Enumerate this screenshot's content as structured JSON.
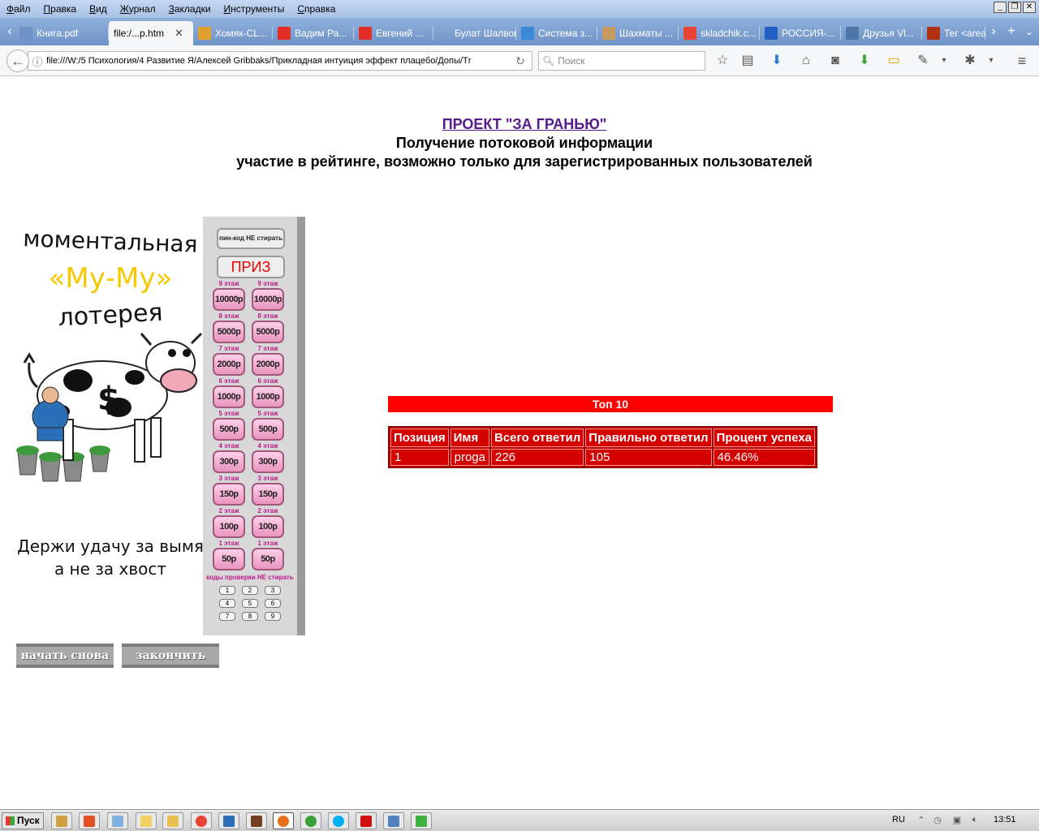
{
  "menu": [
    "Файл",
    "Правка",
    "Вид",
    "Журнал",
    "Закладки",
    "Инструменты",
    "Справка"
  ],
  "tabs": [
    {
      "label": "Книга.pdf",
      "icon": "pdf-icon",
      "color": "#6f93c6",
      "active": false
    },
    {
      "label": "file:/...p.htm",
      "icon": "none",
      "color": "#f5f6f7",
      "active": true
    },
    {
      "label": "Хомяк-CL...",
      "icon": "hamster-icon",
      "color": "#e0a030",
      "active": false
    },
    {
      "label": "Вадим Ра...",
      "icon": "youtube-icon",
      "color": "#e52d27",
      "active": false
    },
    {
      "label": "Евгений ...",
      "icon": "youtube-icon",
      "color": "#e52d27",
      "active": false
    },
    {
      "label": "Булат Шалвов...",
      "icon": "none",
      "color": "#6f93c6",
      "active": false
    },
    {
      "label": "Система з...",
      "icon": "system-icon",
      "color": "#3a88d8",
      "active": false
    },
    {
      "label": "Шахматы ...",
      "icon": "chess-icon",
      "color": "#c89a60",
      "active": false
    },
    {
      "label": "skladchik.c...",
      "icon": "chrome-icon",
      "color": "#ea4335",
      "active": false
    },
    {
      "label": "РОССИЯ-...",
      "icon": "russia-icon",
      "color": "#2060c0",
      "active": false
    },
    {
      "label": "Друзья Vl...",
      "icon": "vk-icon",
      "color": "#4a76a8",
      "active": false
    },
    {
      "label": "Тег <area>",
      "icon": "htmlbook-icon",
      "color": "#b03010",
      "active": false
    }
  ],
  "url": "file:///W:/5 Психология/4 Развитие Я/Алексей Gribbaks/Прикладная интуиция эффект плацебо/Допы/Тr",
  "search_placeholder": "Поиск",
  "page": {
    "project_link": "ПРОЕКТ \"ЗА ГРАНЬЮ\"",
    "subtitle": "Получение потоковой информации",
    "subtitle2": "участие в рейтинге, возможно только для зарегистрированных пользователей"
  },
  "lottery": {
    "line1": "моментальная",
    "line2": "«Му-Му»",
    "line3": "лотерея",
    "slogan1": "Держи удачу за вымя",
    "slogan2": "а не за хвост",
    "pin_label": "пин-код НЕ стирать",
    "prize_label": "ПРИЗ",
    "floors": [
      {
        "label": "9 этаж",
        "value": "10000р"
      },
      {
        "label": "8 этаж",
        "value": "5000р"
      },
      {
        "label": "7 этаж",
        "value": "2000р"
      },
      {
        "label": "6 этаж",
        "value": "1000р"
      },
      {
        "label": "5 этаж",
        "value": "500р"
      },
      {
        "label": "4 этаж",
        "value": "300р"
      },
      {
        "label": "3 этаж",
        "value": "150р"
      },
      {
        "label": "2 этаж",
        "value": "100р"
      },
      {
        "label": "1 этаж",
        "value": "50р"
      }
    ],
    "codes_label": "коды проверки НЕ стирать",
    "codes": [
      "1",
      "2",
      "3",
      "4",
      "5",
      "6",
      "7",
      "8",
      "9"
    ]
  },
  "buttons": {
    "restart": "начать снова",
    "finish": "закончить"
  },
  "top10": {
    "title": "Топ 10",
    "headers": [
      "Позиция",
      "Имя",
      "Всего ответил",
      "Правильно ответил",
      "Процент успеха"
    ],
    "rows": [
      [
        "1",
        "proga",
        "226",
        "105",
        "46.46%"
      ]
    ]
  },
  "taskbar": {
    "start": "Пуск",
    "lang": "RU",
    "clock": "13:51"
  }
}
